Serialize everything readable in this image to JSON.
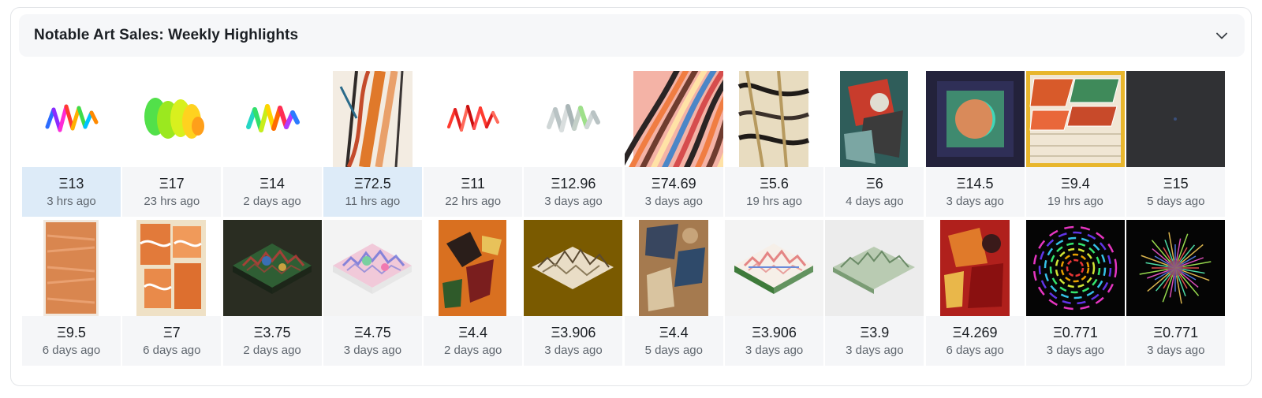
{
  "panel": {
    "title": "Notable Art Sales: Weekly Highlights",
    "collapse_icon": "chevron-down-icon"
  },
  "sales": [
    {
      "price": "Ξ13",
      "time": "3 hrs ago",
      "selected": true,
      "art": "rainbow-squiggle"
    },
    {
      "price": "Ξ17",
      "time": "23 hrs ago",
      "selected": false,
      "art": "green-yellow-blobs"
    },
    {
      "price": "Ξ14",
      "time": "2 days ago",
      "selected": false,
      "art": "rainbow-wave"
    },
    {
      "price": "Ξ72.5",
      "time": "11 hrs ago",
      "selected": true,
      "art": "orange-stripes"
    },
    {
      "price": "Ξ11",
      "time": "22 hrs ago",
      "selected": false,
      "art": "red-squiggle"
    },
    {
      "price": "Ξ12.96",
      "time": "3 days ago",
      "selected": false,
      "art": "grey-squiggle"
    },
    {
      "price": "Ξ74.69",
      "time": "3 days ago",
      "selected": false,
      "art": "pink-swirl-stripes"
    },
    {
      "price": "Ξ5.6",
      "time": "19 hrs ago",
      "selected": false,
      "art": "beige-marble"
    },
    {
      "price": "Ξ6",
      "time": "4 days ago",
      "selected": false,
      "art": "teal-collage"
    },
    {
      "price": "Ξ14.5",
      "time": "3 days ago",
      "selected": false,
      "art": "moon-square"
    },
    {
      "price": "Ξ9.4",
      "time": "19 hrs ago",
      "selected": false,
      "art": "isometric-blocks"
    },
    {
      "price": "Ξ15",
      "time": "5 days ago",
      "selected": false,
      "art": "dark-square"
    },
    {
      "price": "Ξ9.5",
      "time": "6 days ago",
      "selected": false,
      "art": "orange-texture"
    },
    {
      "price": "Ξ7",
      "time": "6 days ago",
      "selected": false,
      "art": "orange-patchwork"
    },
    {
      "price": "Ξ3.75",
      "time": "2 days ago",
      "selected": false,
      "art": "green-terrain"
    },
    {
      "price": "Ξ4.75",
      "time": "3 days ago",
      "selected": false,
      "art": "pastel-terrain"
    },
    {
      "price": "Ξ4.4",
      "time": "2 days ago",
      "selected": false,
      "art": "camo-orange"
    },
    {
      "price": "Ξ3.906",
      "time": "3 days ago",
      "selected": false,
      "art": "mustard-terrain"
    },
    {
      "price": "Ξ4.4",
      "time": "5 days ago",
      "selected": false,
      "art": "blue-brown-collage"
    },
    {
      "price": "Ξ3.906",
      "time": "3 days ago",
      "selected": false,
      "art": "white-terrain"
    },
    {
      "price": "Ξ3.9",
      "time": "3 days ago",
      "selected": false,
      "art": "sage-terrain"
    },
    {
      "price": "Ξ4.269",
      "time": "6 days ago",
      "selected": false,
      "art": "red-collage"
    },
    {
      "price": "Ξ0.771",
      "time": "3 days ago",
      "selected": false,
      "art": "rainbow-spiral"
    },
    {
      "price": "Ξ0.771",
      "time": "3 days ago",
      "selected": false,
      "art": "starburst"
    }
  ]
}
